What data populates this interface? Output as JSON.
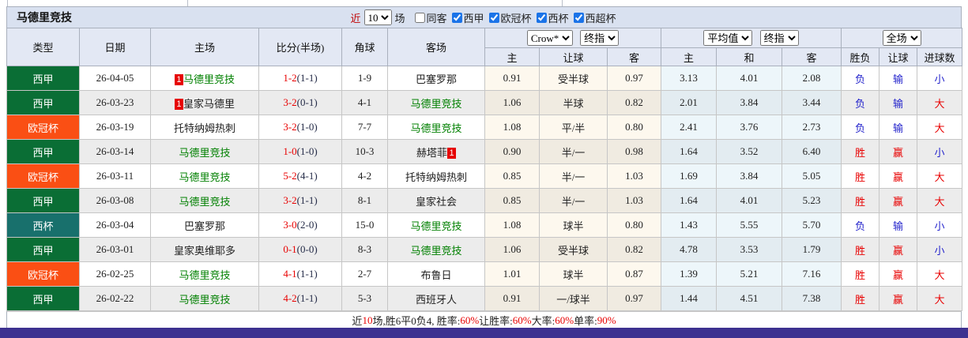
{
  "header": {
    "title": "马德里竞技",
    "recent": {
      "prefix": "近",
      "value": "10",
      "suffix": "场"
    },
    "checkboxes": [
      {
        "label": "同客",
        "checked": false
      },
      {
        "label": "西甲",
        "checked": true
      },
      {
        "label": "欧冠杯",
        "checked": true
      },
      {
        "label": "西杯",
        "checked": true
      },
      {
        "label": "西超杯",
        "checked": true
      }
    ]
  },
  "selectors": {
    "handicap_source": "Crow*",
    "handicap_time": "终指",
    "europe_source": "平均值",
    "europe_time": "终指",
    "scope": "全场"
  },
  "columns": {
    "type": "类型",
    "date": "日期",
    "home": "主场",
    "score": "比分(半场)",
    "corner": "角球",
    "away": "客场",
    "h_home": "主",
    "h_line": "让球",
    "h_away": "客",
    "e_home": "主",
    "e_draw": "和",
    "e_away": "客",
    "result": "胜负",
    "handicap_result": "让球",
    "goals": "进球数"
  },
  "league_colors": {
    "西甲": "#0a6e35",
    "欧冠杯": "#fa4f14",
    "西杯": "#18706c"
  },
  "colors": {
    "accent_red": "#e80000",
    "accent_blue": "#2424cc",
    "team_green": "#008000",
    "titlebar_bg": "#d9e1f0",
    "header_bg": "#e3e8f4",
    "bottom_bar": "#3d3190"
  },
  "rows": [
    {
      "league": "西甲",
      "date": "26-04-05",
      "home": {
        "name": "马德里竞技",
        "tone": "self",
        "card_before": "1",
        "card_after": ""
      },
      "score": {
        "ft": "1-2",
        "ht": "(1-1)"
      },
      "corner": "1-9",
      "away": {
        "name": "巴塞罗那",
        "tone": "other",
        "card_before": "",
        "card_after": ""
      },
      "handicap": {
        "home": "0.91",
        "line": "受半球",
        "away": "0.97"
      },
      "europe": {
        "home": "3.13",
        "draw": "4.01",
        "away": "2.08"
      },
      "outcome": {
        "result": "负",
        "result_color": "blue",
        "handicap": "输",
        "handicap_color": "blue",
        "goals": "小",
        "goals_color": "blue"
      }
    },
    {
      "league": "西甲",
      "date": "26-03-23",
      "home": {
        "name": "皇家马德里",
        "tone": "other",
        "card_before": "1",
        "card_after": ""
      },
      "score": {
        "ft": "3-2",
        "ht": "(0-1)"
      },
      "corner": "4-1",
      "away": {
        "name": "马德里竞技",
        "tone": "self",
        "card_before": "",
        "card_after": ""
      },
      "handicap": {
        "home": "1.06",
        "line": "半球",
        "away": "0.82"
      },
      "europe": {
        "home": "2.01",
        "draw": "3.84",
        "away": "3.44"
      },
      "outcome": {
        "result": "负",
        "result_color": "blue",
        "handicap": "输",
        "handicap_color": "blue",
        "goals": "大",
        "goals_color": "red"
      }
    },
    {
      "league": "欧冠杯",
      "date": "26-03-19",
      "home": {
        "name": "托特纳姆热刺",
        "tone": "other",
        "card_before": "",
        "card_after": ""
      },
      "score": {
        "ft": "3-2",
        "ht": "(1-0)"
      },
      "corner": "7-7",
      "away": {
        "name": "马德里竞技",
        "tone": "self",
        "card_before": "",
        "card_after": ""
      },
      "handicap": {
        "home": "1.08",
        "line": "平/半",
        "away": "0.80"
      },
      "europe": {
        "home": "2.41",
        "draw": "3.76",
        "away": "2.73"
      },
      "outcome": {
        "result": "负",
        "result_color": "blue",
        "handicap": "输",
        "handicap_color": "blue",
        "goals": "大",
        "goals_color": "red"
      }
    },
    {
      "league": "西甲",
      "date": "26-03-14",
      "home": {
        "name": "马德里竞技",
        "tone": "self",
        "card_before": "",
        "card_after": ""
      },
      "score": {
        "ft": "1-0",
        "ht": "(1-0)"
      },
      "corner": "10-3",
      "away": {
        "name": "赫塔菲",
        "tone": "other",
        "card_before": "",
        "card_after": "1"
      },
      "handicap": {
        "home": "0.90",
        "line": "半/一",
        "away": "0.98"
      },
      "europe": {
        "home": "1.64",
        "draw": "3.52",
        "away": "6.40"
      },
      "outcome": {
        "result": "胜",
        "result_color": "red",
        "handicap": "赢",
        "handicap_color": "red",
        "goals": "小",
        "goals_color": "blue"
      }
    },
    {
      "league": "欧冠杯",
      "date": "26-03-11",
      "home": {
        "name": "马德里竞技",
        "tone": "self",
        "card_before": "",
        "card_after": ""
      },
      "score": {
        "ft": "5-2",
        "ht": "(4-1)"
      },
      "corner": "4-2",
      "away": {
        "name": "托特纳姆热刺",
        "tone": "other",
        "card_before": "",
        "card_after": ""
      },
      "handicap": {
        "home": "0.85",
        "line": "半/一",
        "away": "1.03"
      },
      "europe": {
        "home": "1.69",
        "draw": "3.84",
        "away": "5.05"
      },
      "outcome": {
        "result": "胜",
        "result_color": "red",
        "handicap": "赢",
        "handicap_color": "red",
        "goals": "大",
        "goals_color": "red"
      }
    },
    {
      "league": "西甲",
      "date": "26-03-08",
      "home": {
        "name": "马德里竞技",
        "tone": "self",
        "card_before": "",
        "card_after": ""
      },
      "score": {
        "ft": "3-2",
        "ht": "(1-1)"
      },
      "corner": "8-1",
      "away": {
        "name": "皇家社会",
        "tone": "other",
        "card_before": "",
        "card_after": ""
      },
      "handicap": {
        "home": "0.85",
        "line": "半/一",
        "away": "1.03"
      },
      "europe": {
        "home": "1.64",
        "draw": "4.01",
        "away": "5.23"
      },
      "outcome": {
        "result": "胜",
        "result_color": "red",
        "handicap": "赢",
        "handicap_color": "red",
        "goals": "大",
        "goals_color": "red"
      }
    },
    {
      "league": "西杯",
      "date": "26-03-04",
      "home": {
        "name": "巴塞罗那",
        "tone": "other",
        "card_before": "",
        "card_after": ""
      },
      "score": {
        "ft": "3-0",
        "ht": "(2-0)"
      },
      "corner": "15-0",
      "away": {
        "name": "马德里竞技",
        "tone": "self",
        "card_before": "",
        "card_after": ""
      },
      "handicap": {
        "home": "1.08",
        "line": "球半",
        "away": "0.80"
      },
      "europe": {
        "home": "1.43",
        "draw": "5.55",
        "away": "5.70"
      },
      "outcome": {
        "result": "负",
        "result_color": "blue",
        "handicap": "输",
        "handicap_color": "blue",
        "goals": "小",
        "goals_color": "blue"
      }
    },
    {
      "league": "西甲",
      "date": "26-03-01",
      "home": {
        "name": "皇家奥维耶多",
        "tone": "other",
        "card_before": "",
        "card_after": ""
      },
      "score": {
        "ft": "0-1",
        "ht": "(0-0)"
      },
      "corner": "8-3",
      "away": {
        "name": "马德里竞技",
        "tone": "self",
        "card_before": "",
        "card_after": ""
      },
      "handicap": {
        "home": "1.06",
        "line": "受半球",
        "away": "0.82"
      },
      "europe": {
        "home": "4.78",
        "draw": "3.53",
        "away": "1.79"
      },
      "outcome": {
        "result": "胜",
        "result_color": "red",
        "handicap": "赢",
        "handicap_color": "red",
        "goals": "小",
        "goals_color": "blue"
      }
    },
    {
      "league": "欧冠杯",
      "date": "26-02-25",
      "home": {
        "name": "马德里竞技",
        "tone": "self",
        "card_before": "",
        "card_after": ""
      },
      "score": {
        "ft": "4-1",
        "ht": "(1-1)"
      },
      "corner": "2-7",
      "away": {
        "name": "布鲁日",
        "tone": "other",
        "card_before": "",
        "card_after": ""
      },
      "handicap": {
        "home": "1.01",
        "line": "球半",
        "away": "0.87"
      },
      "europe": {
        "home": "1.39",
        "draw": "5.21",
        "away": "7.16"
      },
      "outcome": {
        "result": "胜",
        "result_color": "red",
        "handicap": "赢",
        "handicap_color": "red",
        "goals": "大",
        "goals_color": "red"
      }
    },
    {
      "league": "西甲",
      "date": "26-02-22",
      "home": {
        "name": "马德里竞技",
        "tone": "self",
        "card_before": "",
        "card_after": ""
      },
      "score": {
        "ft": "4-2",
        "ht": "(1-1)"
      },
      "corner": "5-3",
      "away": {
        "name": "西班牙人",
        "tone": "other",
        "card_before": "",
        "card_after": ""
      },
      "handicap": {
        "home": "0.91",
        "line": "一/球半",
        "away": "0.97"
      },
      "europe": {
        "home": "1.44",
        "draw": "4.51",
        "away": "7.38"
      },
      "outcome": {
        "result": "胜",
        "result_color": "red",
        "handicap": "赢",
        "handicap_color": "red",
        "goals": "大",
        "goals_color": "red"
      }
    }
  ],
  "footer": {
    "segments": [
      {
        "text": "近",
        "color": "dark"
      },
      {
        "text": "10",
        "color": "red"
      },
      {
        "text": "场,胜6平0负4, 胜率:",
        "color": "dark"
      },
      {
        "text": "60%",
        "color": "red"
      },
      {
        "text": " 让胜率:",
        "color": "dark"
      },
      {
        "text": "60%",
        "color": "red"
      },
      {
        "text": " 大率:",
        "color": "dark"
      },
      {
        "text": "60%",
        "color": "red"
      },
      {
        "text": " 单率:",
        "color": "dark"
      },
      {
        "text": "90%",
        "color": "red"
      }
    ]
  }
}
